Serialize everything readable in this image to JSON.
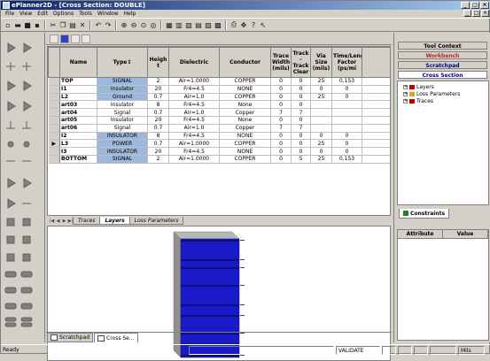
{
  "window": {
    "title": "ePlanner2D - [Cross Section: DOUBLE]"
  },
  "menu": [
    "File",
    "View",
    "Edit",
    "Options",
    "Tools",
    "Window",
    "Help"
  ],
  "grid": {
    "headers": [
      "Name",
      "Type↕",
      "Height",
      "Dielectric",
      "Conductor",
      "Trace Width (mils)",
      "Track -Track Clear",
      "Via Size (mils)",
      "Time/Length Factor (ps/mi"
    ],
    "rows": [
      {
        "marker": "",
        "name": "TOP",
        "type": "SIGNAL",
        "height": "2",
        "dielectric": "Air=1.0000",
        "conductor": "COPPER",
        "trace": "0",
        "clear": "0",
        "via": "25",
        "tlf": "0.153",
        "sel": true
      },
      {
        "marker": "",
        "name": "I1",
        "type": "Insulator",
        "height": "20",
        "dielectric": "Fr4=4.5",
        "conductor": "NONE",
        "trace": "0",
        "clear": "0",
        "via": "0",
        "tlf": "0",
        "sel": true
      },
      {
        "marker": "",
        "name": "L2",
        "type": "Ground",
        "height": "0.7",
        "dielectric": "Air=1.0",
        "conductor": "COPPER",
        "trace": "0",
        "clear": "0",
        "via": "25",
        "tlf": "0",
        "sel": true
      },
      {
        "marker": "",
        "name": "art03",
        "type": "Insulator",
        "height": "8",
        "dielectric": "Fr4=4.5",
        "conductor": "None",
        "trace": "0",
        "clear": "0",
        "via": "",
        "tlf": "",
        "sel": false
      },
      {
        "marker": "",
        "name": "art04",
        "type": "Signal",
        "height": "0.7",
        "dielectric": "Air=1.0",
        "conductor": "Copper",
        "trace": "7",
        "clear": "7",
        "via": "",
        "tlf": "",
        "sel": false
      },
      {
        "marker": "",
        "name": "art05",
        "type": "Insulator",
        "height": "20",
        "dielectric": "Fr4=4.5",
        "conductor": "None",
        "trace": "0",
        "clear": "0",
        "via": "",
        "tlf": "",
        "sel": false
      },
      {
        "marker": "",
        "name": "art06",
        "type": "Signal",
        "height": "0.7",
        "dielectric": "Air=1.0",
        "conductor": "Copper",
        "trace": "7",
        "clear": "7",
        "via": "",
        "tlf": "",
        "sel": false
      },
      {
        "marker": "",
        "name": "I2",
        "type": "INSULATOR",
        "height": "8",
        "dielectric": "Fr4=4.5",
        "conductor": "NONE",
        "trace": "0",
        "clear": "0",
        "via": "0",
        "tlf": "0",
        "sel": true
      },
      {
        "marker": "▶",
        "name": "L3",
        "type": "POWER",
        "height": "0.7",
        "dielectric": "Air=1.0000",
        "conductor": "COPPER",
        "trace": "0",
        "clear": "0",
        "via": "25",
        "tlf": "0",
        "sel": true
      },
      {
        "marker": "",
        "name": "I3",
        "type": "INSULATOR",
        "height": "20",
        "dielectric": "Fr4=4.5",
        "conductor": "NONE",
        "trace": "0",
        "clear": "0",
        "via": "0",
        "tlf": "0",
        "sel": true
      },
      {
        "marker": "",
        "name": "BOTTOM",
        "type": "SIGNAL",
        "height": "2",
        "dielectric": "Air=1.0000",
        "conductor": "COPPER",
        "trace": "0",
        "clear": "5",
        "via": "25",
        "tlf": "0.153",
        "sel": true
      }
    ]
  },
  "bottom_tabs": [
    "Traces",
    "Layers",
    "Loss Parameters"
  ],
  "doc_tabs": [
    "Scratchpad",
    "Cross Se..."
  ],
  "right_panel": {
    "tool_context": "Tool Context",
    "workbench": "Workbench",
    "scratchpad": "Scratchpad",
    "cross_section": "Cross Section",
    "tree": [
      {
        "label": "Layers",
        "color": "#c00000"
      },
      {
        "label": "Loss Parameters",
        "color": "#e0a020"
      },
      {
        "label": "Traces",
        "color": "#c00000"
      }
    ],
    "constraints_tab": "Constraints",
    "prop_headers": [
      "Attribute",
      "Value"
    ]
  },
  "status": {
    "left": "Ready",
    "mid": "VALIDATE",
    "unit": "Mils"
  },
  "colors": {
    "workbench_red": "#c02020",
    "cross_section_blue": "#000080",
    "stack_blue": "#1a1ac8",
    "stack_dark": "#0a0a70"
  }
}
